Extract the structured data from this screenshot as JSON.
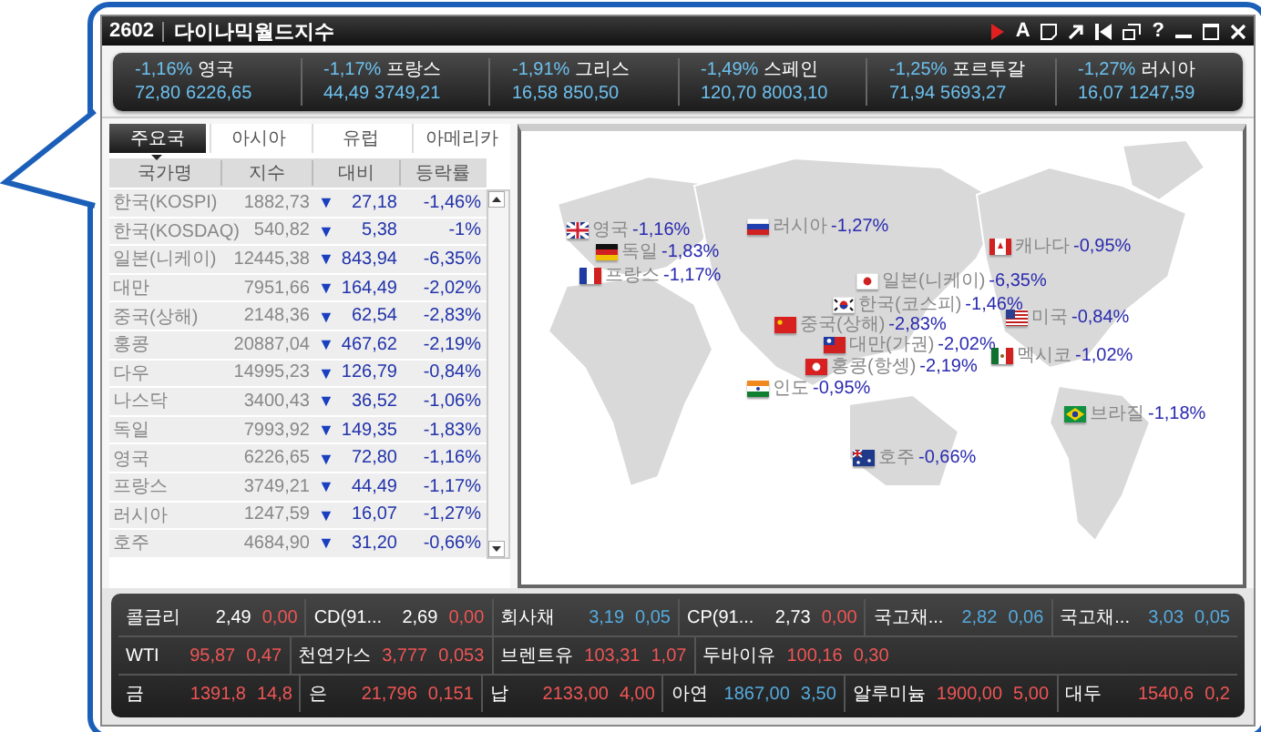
{
  "window": {
    "code": "2602",
    "title": "다이나믹월드지수",
    "tools": [
      {
        "kind": "play"
      },
      {
        "kind": "text",
        "label": "A"
      },
      {
        "kind": "note"
      },
      {
        "kind": "arrow"
      },
      {
        "kind": "first"
      },
      {
        "kind": "windows"
      },
      {
        "kind": "text",
        "label": "?"
      },
      {
        "kind": "minimize"
      },
      {
        "kind": "maximize"
      },
      {
        "kind": "close"
      }
    ]
  },
  "ticker": [
    {
      "change": "-1,16%",
      "name": "영국",
      "diff": "72,80",
      "value": "6226,65"
    },
    {
      "change": "-1,17%",
      "name": "프랑스",
      "diff": "44,49",
      "value": "3749,21"
    },
    {
      "change": "-1,91%",
      "name": "그리스",
      "diff": "16,58",
      "value": "850,50"
    },
    {
      "change": "-1,49%",
      "name": "스페인",
      "diff": "120,70",
      "value": "8003,10"
    },
    {
      "change": "-1,25%",
      "name": "포르투갈",
      "diff": "71,94",
      "value": "5693,27"
    },
    {
      "change": "-1,27%",
      "name": "러시아",
      "diff": "16,07",
      "value": "1247,59"
    }
  ],
  "region_tabs": [
    {
      "label": "주요국",
      "selected": true
    },
    {
      "label": "아시아",
      "selected": false
    },
    {
      "label": "유럽",
      "selected": false
    },
    {
      "label": "아메리카",
      "selected": false
    }
  ],
  "table": {
    "columns": [
      "국가명",
      "지수",
      "대비",
      "등락률"
    ],
    "rows": [
      {
        "name": "한국(KOSPI)",
        "index": "1882,73",
        "arrow": "▼",
        "diff": "27,18",
        "rate": "-1,46%"
      },
      {
        "name": "한국(KOSDAQ)",
        "index": "540,82",
        "arrow": "▼",
        "diff": "5,38",
        "rate": "-1%"
      },
      {
        "name": "일본(니케이)",
        "index": "12445,38",
        "arrow": "▼",
        "diff": "843,94",
        "rate": "-6,35%"
      },
      {
        "name": "대만",
        "index": "7951,66",
        "arrow": "▼",
        "diff": "164,49",
        "rate": "-2,02%"
      },
      {
        "name": "중국(상해)",
        "index": "2148,36",
        "arrow": "▼",
        "diff": "62,54",
        "rate": "-2,83%"
      },
      {
        "name": "홍콩",
        "index": "20887,04",
        "arrow": "▼",
        "diff": "467,62",
        "rate": "-2,19%"
      },
      {
        "name": "다우",
        "index": "14995,23",
        "arrow": "▼",
        "diff": "126,79",
        "rate": "-0,84%"
      },
      {
        "name": "나스닥",
        "index": "3400,43",
        "arrow": "▼",
        "diff": "36,52",
        "rate": "-1,06%"
      },
      {
        "name": "독일",
        "index": "7993,92",
        "arrow": "▼",
        "diff": "149,35",
        "rate": "-1,83%"
      },
      {
        "name": "영국",
        "index": "6226,65",
        "arrow": "▼",
        "diff": "72,80",
        "rate": "-1,16%"
      },
      {
        "name": "프랑스",
        "index": "3749,21",
        "arrow": "▼",
        "diff": "44,49",
        "rate": "-1,17%"
      },
      {
        "name": "러시아",
        "index": "1247,59",
        "arrow": "▼",
        "diff": "16,07",
        "rate": "-1,27%"
      },
      {
        "name": "호주",
        "index": "4684,90",
        "arrow": "▼",
        "diff": "31,20",
        "rate": "-0,66%"
      }
    ]
  },
  "map": {
    "markers": [
      {
        "kind": "ru",
        "name": "러시아",
        "change": "-1,27%"
      },
      {
        "kind": "uk",
        "name": "영국",
        "change": "-1,16%"
      },
      {
        "kind": "ca",
        "name": "캐나다",
        "change": "-0,95%"
      },
      {
        "kind": "de",
        "name": "독일",
        "change": "-1,83%"
      },
      {
        "kind": "fr",
        "name": "프랑스",
        "change": "-1,17%"
      },
      {
        "kind": "jp",
        "name": "일본(니케이)",
        "change": "-6,35%"
      },
      {
        "kind": "kr",
        "name": "한국(코스피)",
        "change": "-1,46%"
      },
      {
        "kind": "cn",
        "name": "중국(상해)",
        "change": "-2,83%"
      },
      {
        "kind": "us",
        "name": "미국",
        "change": "-0,84%"
      },
      {
        "kind": "tw",
        "name": "대만(가권)",
        "change": "-2,02%"
      },
      {
        "kind": "hk",
        "name": "홍콩(항셍)",
        "change": "-2,19%"
      },
      {
        "kind": "mx",
        "name": "멕시코",
        "change": "-1,02%"
      },
      {
        "kind": "in",
        "name": "인도",
        "change": "-0,95%"
      },
      {
        "kind": "br",
        "name": "브라질",
        "change": "-1,18%"
      },
      {
        "kind": "au",
        "name": "호주",
        "change": "-0,66%"
      }
    ]
  },
  "commodities": [
    [
      {
        "name": "콜금리",
        "value": "2,49",
        "change": "0,00",
        "rising": true,
        "unchanged": true
      },
      {
        "name": "CD(91...",
        "value": "2,69",
        "change": "0,00",
        "rising": true,
        "unchanged": true
      },
      {
        "name": "회사채",
        "value": "3,19",
        "change": "0,05",
        "rising": false,
        "unchanged": false
      },
      {
        "name": "CP(91...",
        "value": "2,73",
        "change": "0,00",
        "rising": true,
        "unchanged": true
      },
      {
        "name": "국고채...",
        "value": "2,82",
        "change": "0,06",
        "rising": false,
        "unchanged": false
      },
      {
        "name": "국고채...",
        "value": "3,03",
        "change": "0,05",
        "rising": false,
        "unchanged": false
      }
    ],
    [
      {
        "name": "WTI",
        "value": "95,87",
        "change": "0,47",
        "rising": true,
        "unchanged": false
      },
      {
        "name": "천연가스",
        "value": "3,777",
        "change": "0,053",
        "rising": true,
        "unchanged": false
      },
      {
        "name": "브렌트유",
        "value": "103,31",
        "change": "1,07",
        "rising": true,
        "unchanged": false
      },
      {
        "name": "두바이유",
        "value": "100,16",
        "change": "0,30",
        "rising": true,
        "unchanged": false
      }
    ],
    [
      {
        "name": "금",
        "value": "1391,8",
        "change": "14,8",
        "rising": true,
        "unchanged": false
      },
      {
        "name": "은",
        "value": "21,796",
        "change": "0,151",
        "rising": true,
        "unchanged": false
      },
      {
        "name": "납",
        "value": "2133,00",
        "change": "4,00",
        "rising": true,
        "unchanged": false
      },
      {
        "name": "아연",
        "value": "1867,00",
        "change": "3,50",
        "rising": false,
        "unchanged": false
      },
      {
        "name": "알루미늄",
        "value": "1900,00",
        "change": "5,00",
        "rising": true,
        "unchanged": false
      },
      {
        "name": "대두",
        "value": "1540,6",
        "change": "0,2",
        "rising": true,
        "unchanged": false
      }
    ]
  ]
}
